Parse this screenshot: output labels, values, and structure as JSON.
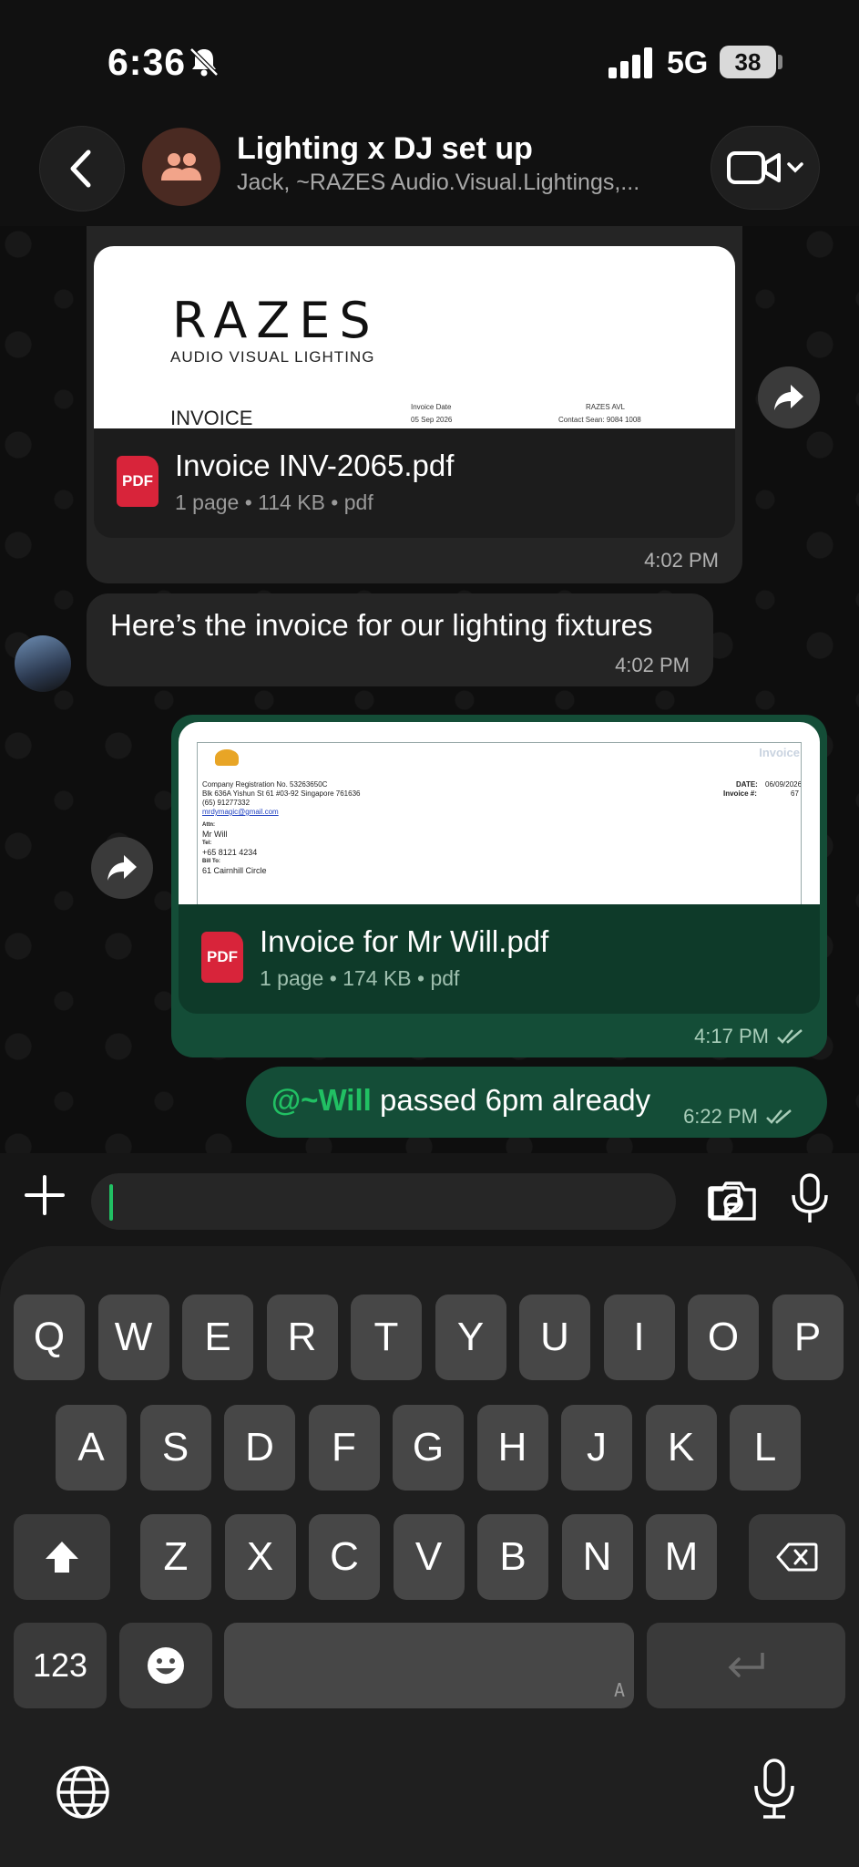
{
  "status_bar": {
    "time": "6:36",
    "network": "5G",
    "battery": "38"
  },
  "header": {
    "title": "Lighting x DJ set up",
    "subtitle": "Jack, ~RAZES Audio.Visual.Lightings,..."
  },
  "messages": [
    {
      "type": "document",
      "direction": "incoming",
      "preview": {
        "brand": "RAZES",
        "brand_sub": "AUDIO VISUAL LIGHTING",
        "doc_heading": "INVOICE",
        "invoice_date_label": "Invoice Date",
        "invoice_date": "05 Sep 2026",
        "contact_name": "RAZES AVL",
        "contact_line": "Contact Sean: 9084 1008"
      },
      "file_name": "Invoice INV-2065.pdf",
      "file_meta": "1 page • 114 KB • pdf",
      "time": "4:02 PM"
    },
    {
      "type": "text",
      "direction": "incoming",
      "text": "Here’s the invoice for our lighting fixtures",
      "time": "4:02 PM"
    },
    {
      "type": "document",
      "direction": "outgoing",
      "preview": {
        "heading": "Invoice",
        "company_reg": "Company Registration No. 53263650C",
        "address": "Blk 636A Yishun St 61 #03-92 Singapore 761636",
        "phone": "(65) 91277332",
        "email": "mrdymagic@gmail.com",
        "date_label": "DATE:",
        "date": "06/09/2026",
        "invoice_no_label": "Invoice #:",
        "invoice_no": "67",
        "attn_label": "Attn:",
        "attn_name": "Mr Will",
        "tel_label": "Tel:",
        "tel": "+65 8121 4234",
        "bill_to_label": "Bill To:",
        "bill_to": "61 Cairnhill Circle"
      },
      "file_name": "Invoice for Mr Will.pdf",
      "file_meta": "1 page • 174 KB • pdf",
      "time": "4:17 PM"
    },
    {
      "type": "text",
      "direction": "outgoing",
      "mention": "@~Will",
      "text": "passed 6pm already",
      "time": "6:22 PM"
    }
  ],
  "pdf_badge": "PDF",
  "keyboard": {
    "row1": [
      "Q",
      "W",
      "E",
      "R",
      "T",
      "Y",
      "U",
      "I",
      "O",
      "P"
    ],
    "row2": [
      "A",
      "S",
      "D",
      "F",
      "G",
      "H",
      "J",
      "K",
      "L"
    ],
    "row3": [
      "Z",
      "X",
      "C",
      "V",
      "B",
      "N",
      "M"
    ],
    "numbers_key": "123",
    "space_hint": "A"
  },
  "colors": {
    "accent_green": "#21c063",
    "outgoing_bubble": "#144d37",
    "incoming_bubble": "#252525",
    "pdf_red": "#d8243a"
  }
}
